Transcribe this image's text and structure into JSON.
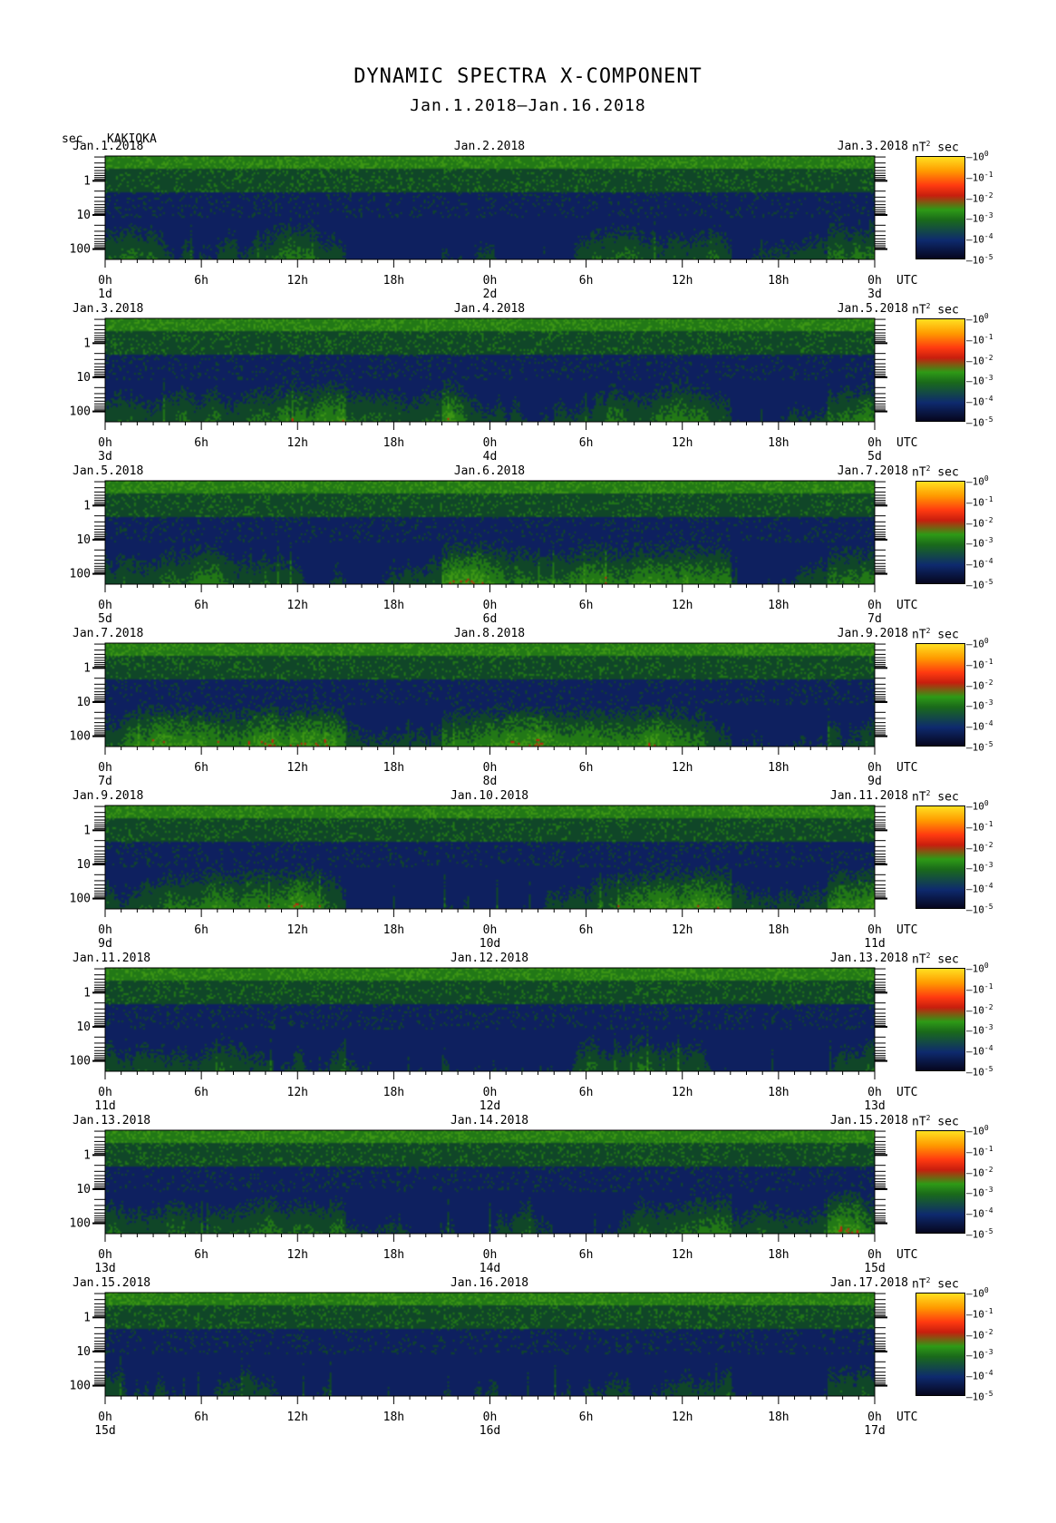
{
  "title": "DYNAMIC SPECTRA X-COMPONENT",
  "date_range": "Jan.1.2018–Jan.16.2018",
  "y_unit": "sec",
  "station": "KAKIOKA",
  "colors": {
    "low": "#06061e",
    "mid_low": "#0e2a6e",
    "mid": "#2e9a16",
    "high": "#ff3a10",
    "max": "#ffe020"
  },
  "chart_data": {
    "type": "heatmap",
    "title": "DYNAMIC SPECTRA X-COMPONENT",
    "subtitle": "Jan.1.2018–Jan.16.2018",
    "ylabel": "sec",
    "y_ticks": [
      "1",
      "10",
      "100"
    ],
    "x_ticks": [
      "0h",
      "6h",
      "12h",
      "18h",
      "0h",
      "6h",
      "12h",
      "18h",
      "0h"
    ],
    "x_unit": "UTC",
    "colorbar_unit": "nT",
    "colorbar_unit_exp": "2",
    "colorbar_unit_suffix": "sec",
    "colorbar_ticks": [
      {
        "base": "10",
        "exp": "0"
      },
      {
        "base": "10",
        "exp": "-1"
      },
      {
        "base": "10",
        "exp": "-2"
      },
      {
        "base": "10",
        "exp": "-3"
      },
      {
        "base": "10",
        "exp": "-4"
      },
      {
        "base": "10",
        "exp": "-5"
      }
    ],
    "panels": [
      {
        "start_label": "Jan.1.2018",
        "mid_label": "Jan.2.2018",
        "end_label": "Jan.3.2018",
        "day_labels": [
          "1d",
          "2d",
          "3d"
        ]
      },
      {
        "start_label": "Jan.3.2018",
        "mid_label": "Jan.4.2018",
        "end_label": "Jan.5.2018",
        "day_labels": [
          "3d",
          "4d",
          "5d"
        ]
      },
      {
        "start_label": "Jan.5.2018",
        "mid_label": "Jan.6.2018",
        "end_label": "Jan.7.2018",
        "day_labels": [
          "5d",
          "6d",
          "7d"
        ]
      },
      {
        "start_label": "Jan.7.2018",
        "mid_label": "Jan.8.2018",
        "end_label": "Jan.9.2018",
        "day_labels": [
          "7d",
          "8d",
          "9d"
        ]
      },
      {
        "start_label": "Jan.9.2018",
        "mid_label": "Jan.10.2018",
        "end_label": "Jan.11.2018",
        "day_labels": [
          "9d",
          "10d",
          "11d"
        ]
      },
      {
        "start_label": "Jan.11.2018",
        "mid_label": "Jan.12.2018",
        "end_label": "Jan.13.2018",
        "day_labels": [
          "11d",
          "12d",
          "13d"
        ]
      },
      {
        "start_label": "Jan.13.2018",
        "mid_label": "Jan.14.2018",
        "end_label": "Jan.15.2018",
        "day_labels": [
          "13d",
          "14d",
          "15d"
        ]
      },
      {
        "start_label": "Jan.15.2018",
        "mid_label": "Jan.16.2018",
        "end_label": "Jan.17.2018",
        "day_labels": [
          "15d",
          "16d",
          "17d"
        ]
      }
    ]
  }
}
